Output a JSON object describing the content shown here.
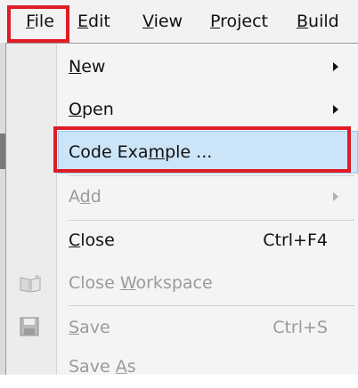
{
  "menubar": {
    "file": {
      "before": "",
      "ul": "F",
      "after": "ile"
    },
    "edit": {
      "before": "",
      "ul": "E",
      "after": "dit"
    },
    "view": {
      "before": "",
      "ul": "V",
      "after": "iew"
    },
    "project": {
      "before": "",
      "ul": "P",
      "after": "roject"
    },
    "build": {
      "before": "",
      "ul": "B",
      "after": "uild"
    }
  },
  "file_menu": {
    "new": {
      "before": "",
      "ul": "N",
      "after": "ew"
    },
    "open": {
      "before": "",
      "ul": "O",
      "after": "pen"
    },
    "code_example": {
      "before": "Code Exa",
      "ul": "m",
      "after": "ple ..."
    },
    "add": {
      "before": "A",
      "ul": "d",
      "after": "d"
    },
    "close": {
      "before": "",
      "ul": "C",
      "after": "lose",
      "shortcut": "Ctrl+F4"
    },
    "close_workspace": {
      "before": "Close ",
      "ul": "W",
      "after": "orkspace"
    },
    "save": {
      "before": "",
      "ul": "S",
      "after": "ave",
      "shortcut": "Ctrl+S"
    },
    "save_as": {
      "before": "Save ",
      "ul": "A",
      "after": "s"
    }
  },
  "colors": {
    "annotation_red": "#e01b24",
    "hover_blue": "#cce4f7"
  },
  "icons": {
    "close_workspace": "book-icon",
    "save": "floppy-disk-icon"
  }
}
